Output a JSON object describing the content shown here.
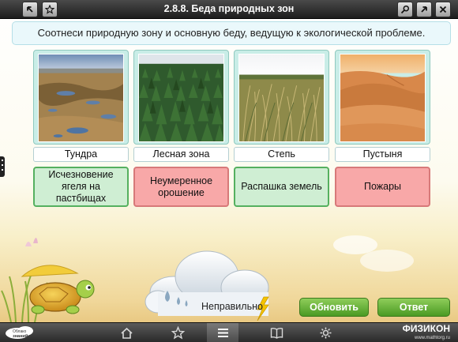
{
  "header": {
    "title": "2.8.8. Беда природных зон"
  },
  "task": {
    "text": "Соотнеси природную зону и основную беду, ведущую к экологической проблеме."
  },
  "zones": [
    {
      "label": "Тундра",
      "problem": "Исчезновение ягеля на пастбищах",
      "problem_state": "green"
    },
    {
      "label": "Лесная зона",
      "problem": "Неумеренное орошение",
      "problem_state": "red"
    },
    {
      "label": "Степь",
      "problem": "Распашка земель",
      "problem_state": "green"
    },
    {
      "label": "Пустыня",
      "problem": "Пожары",
      "problem_state": "red"
    }
  ],
  "feedback": {
    "status": "Неправильно"
  },
  "buttons": {
    "refresh": "Обновить",
    "answer": "Ответ"
  },
  "footer": {
    "logo_line1": "Облако",
    "logo_line2": "знаний",
    "brand": "ФИЗИКОН",
    "brand_url": "www.mathtorg.ru"
  },
  "colors": {
    "correct": "#cfeed3",
    "wrong": "#f8a8a8",
    "button": "#5aa82e"
  }
}
